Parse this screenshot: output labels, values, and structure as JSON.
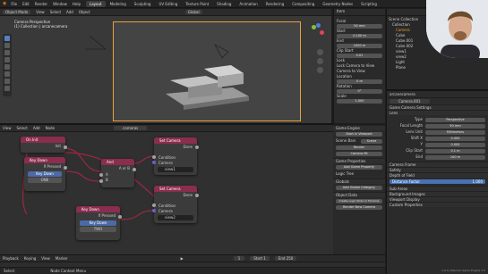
{
  "topbar": {
    "menus": [
      "File",
      "Edit",
      "Render",
      "Window",
      "Help"
    ],
    "workspaces": [
      "Layout",
      "Modeling",
      "Sculpting",
      "UV Editing",
      "Texture Paint",
      "Shading",
      "Animation",
      "Rendering",
      "Compositing",
      "Geometry Nodes",
      "Scripting"
    ],
    "active_workspace": "Layout"
  },
  "viewport": {
    "header_items": [
      "Object Mode",
      "View",
      "Select",
      "Add",
      "Object",
      "Global"
    ],
    "title": "Camera Perspective",
    "subtitle": "(1) Collection | arcanecamera"
  },
  "npanel": {
    "tab": "Item",
    "items": [
      {
        "label": "Focal",
        "value": "50 mm"
      },
      {
        "label": "Start",
        "value": "0.100 m"
      },
      {
        "label": "End",
        "value": "1000 m"
      },
      {
        "label": "Clip Start",
        "value": "0.01"
      },
      {
        "label": "Lock",
        "value": ""
      },
      {
        "label": "Location",
        "value": "0 m"
      },
      {
        "label": "Rotation",
        "value": "0°"
      },
      {
        "label": "Scale",
        "value": "1.000"
      }
    ],
    "checks": [
      "Lock Camera to View",
      "Camera to View"
    ]
  },
  "node_editor": {
    "header_items": [
      "View",
      "Select",
      "Add",
      "Node"
    ],
    "tree_name": "cameras",
    "nodes": {
      "on_init": {
        "title": "On Init",
        "socket": "Init"
      },
      "key_down_1": {
        "title": "Key Down",
        "output": "If Pressed",
        "key": "Key Down",
        "value": "ONE"
      },
      "and": {
        "title": "And",
        "output": "A or B",
        "in_a": "A",
        "in_b": "B"
      },
      "set_camera_1": {
        "title": "Set Camera",
        "done": "Done",
        "condition": "Condition",
        "camera_label": "Camera",
        "camera": "view1"
      },
      "set_camera_2": {
        "title": "Set Camera",
        "done": "Done",
        "condition": "Condition",
        "camera_label": "Camera",
        "camera": "view2"
      },
      "key_down_2": {
        "title": "Key Down",
        "output": "If Pressed",
        "key": "Key Down",
        "value": "TWO"
      }
    }
  },
  "ne_sidebar": {
    "section_game": "Game Engine",
    "buttons": [
      "Start in Viewport",
      "Render",
      "Camera fill"
    ],
    "rows": [
      {
        "label": "Scene Bars",
        "value": "Scene"
      }
    ],
    "section_logic": "Game Properties",
    "logic_btn": "Add Game Property",
    "logic_tree": "Logic Tree",
    "section_globals": "Globals",
    "globals_btn": "Add Global Category",
    "section_object": "Object Data",
    "object_btns": [
      "Create Logic Node in Timeline",
      "Render New Camera"
    ]
  },
  "playback": {
    "items": [
      "Playback",
      "Keying",
      "View",
      "Marker"
    ],
    "frame": "1",
    "start": "Start 1",
    "end": "End 250",
    "status_left": "Select",
    "status_mid": "Node Context Menu"
  },
  "outliner": {
    "title": "Scene Collection",
    "items": [
      "Collection",
      "Camera",
      "Cube",
      "Cube.001",
      "Cube.002",
      "view1",
      "view2",
      "Light",
      "Plane"
    ]
  },
  "properties": {
    "object": "arcanecamera",
    "data": "Camera.001",
    "sections": [
      "Game Camera Settings",
      "Lens",
      "Camera Frame",
      "Safety",
      "Depth of Field",
      "Sub Areas",
      "Background Images",
      "Viewport Display",
      "Custom Properties"
    ],
    "fields": [
      {
        "label": "Type",
        "value": "Perspective"
      },
      {
        "label": "Focal Length",
        "value": "50 mm"
      },
      {
        "label": "Lens Unit",
        "value": "Millimeters"
      },
      {
        "label": "Shift X",
        "value": "0.000"
      },
      {
        "label": "Y",
        "value": "0.000"
      },
      {
        "label": "Clip Start",
        "value": "0.1 m"
      },
      {
        "label": "End",
        "value": "100 m"
      }
    ],
    "dist_label": "Distance Factor",
    "dist_value": "1.000"
  },
  "statusbar": {
    "version": "3.0.0 | Blender Game Engine 3.0",
    "hint": "Node Context Menu"
  },
  "colors": {
    "event_header": "#8a2d4e",
    "action_header": "#8a2d4e",
    "link_red": "#9c2743",
    "socket_grey": "#a1a1a1",
    "socket_purple": "#6363c7",
    "key_button": "#4b6aa8",
    "camera_frame": "#e8a23a",
    "active_orange": "#f0a030"
  }
}
